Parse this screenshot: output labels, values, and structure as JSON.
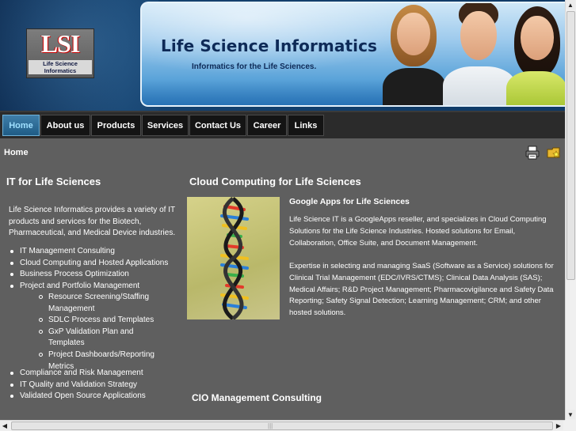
{
  "banner": {
    "logo_text": "LSI",
    "logo_sub_line1": "Life Science",
    "logo_sub_line2": "Informatics",
    "site_title": "Life Science Informatics",
    "tagline": "Informatics for the Life Sciences."
  },
  "nav": {
    "items": [
      {
        "label": "Home",
        "active": true
      },
      {
        "label": "About us",
        "active": false
      },
      {
        "label": "Products",
        "active": false
      },
      {
        "label": "Services",
        "active": false
      },
      {
        "label": "Contact Us",
        "active": false
      },
      {
        "label": "Career",
        "active": false
      },
      {
        "label": "Links",
        "active": false
      }
    ]
  },
  "breadcrumb": "Home",
  "toolbar": {
    "print_icon": "print-icon",
    "bookmark_icon": "bookmark-folder-icon"
  },
  "left": {
    "heading": "IT for Life Sciences",
    "intro": "Life Science Informatics provides a variety of IT products and services for the Biotech, Pharmaceutical, and Medical Device industries.",
    "services": [
      "IT Management Consulting",
      "Cloud Computing and Hosted Applications",
      "Business Process Optimization",
      "Project and Portfolio Management"
    ],
    "subservices": [
      "Resource Screening/Staffing Management",
      "SDLC Process and Templates",
      "GxP Validation Plan and Templates",
      "Project Dashboards/Reporting Metrics"
    ],
    "services2": [
      "Compliance and Risk Management",
      "IT Quality and Validation Strategy",
      "Validated Open Source Applications"
    ]
  },
  "right": {
    "heading": "Cloud Computing for Life Sciences",
    "subheading": "Google Apps for Life Sciences",
    "para1": "Life Science IT is a GoogleApps reseller, and specializes in Cloud Computing Solutions for the Life Science Industries.   Hosted solutions for Email, Collaboration, Office Suite, and Document Management.",
    "para2": "Expertise in selecting and managing SaaS (Software as a Service) solutions for Clinical Trial Management (EDC/IVRS/CTMS); Clinical Data Analysis (SAS); Medical Affairs; R&D Project Management; Pharmacovigilance and Safety Data Reporting;  Safety Signal Detection; Learning Management; CRM; and other hosted solutions.",
    "section2_heading": "CIO Management Consulting"
  },
  "colors": {
    "page_bg": "#5f5f5f",
    "nav_bg": "#2b2b2b",
    "nav_active": "#2b6f9a",
    "title_color": "#0e2a57"
  }
}
